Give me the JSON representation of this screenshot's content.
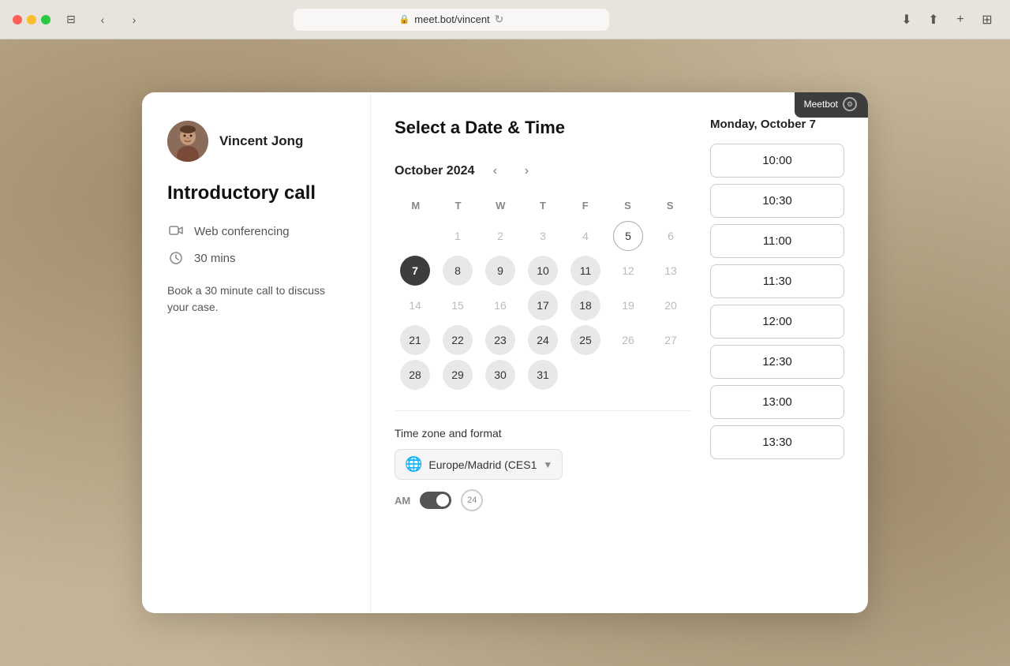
{
  "browser": {
    "url": "meet.bot/vincent",
    "lock_icon": "🔒",
    "refresh_icon": "↻"
  },
  "meetbot": {
    "label": "Meetbot"
  },
  "left_panel": {
    "profile_name": "Vincent Jong",
    "meeting_title": "Introductory call",
    "web_conferencing_label": "Web conferencing",
    "duration_label": "30 mins",
    "description": "Book a 30 minute call to discuss your case."
  },
  "calendar": {
    "section_title": "Select a Date & Time",
    "month_year": "October 2024",
    "weekdays": [
      "M",
      "T",
      "W",
      "T",
      "F",
      "S",
      "S"
    ],
    "selected_date_label": "Monday, October 7",
    "selected_day": 7,
    "days": [
      {
        "day": "",
        "type": "empty"
      },
      {
        "day": 1,
        "type": "inactive"
      },
      {
        "day": 2,
        "type": "inactive"
      },
      {
        "day": 3,
        "type": "inactive"
      },
      {
        "day": 4,
        "type": "inactive"
      },
      {
        "day": 5,
        "type": "today-ring"
      },
      {
        "day": 6,
        "type": "inactive"
      },
      {
        "day": 7,
        "type": "selected"
      },
      {
        "day": 8,
        "type": "available"
      },
      {
        "day": 9,
        "type": "available"
      },
      {
        "day": 10,
        "type": "available"
      },
      {
        "day": 11,
        "type": "available"
      },
      {
        "day": 12,
        "type": "inactive"
      },
      {
        "day": 13,
        "type": "inactive"
      },
      {
        "day": 14,
        "type": "inactive"
      },
      {
        "day": 15,
        "type": "inactive"
      },
      {
        "day": 16,
        "type": "inactive"
      },
      {
        "day": 17,
        "type": "available"
      },
      {
        "day": 18,
        "type": "available"
      },
      {
        "day": 19,
        "type": "inactive"
      },
      {
        "day": 20,
        "type": "inactive"
      },
      {
        "day": 21,
        "type": "available"
      },
      {
        "day": 22,
        "type": "available"
      },
      {
        "day": 23,
        "type": "available"
      },
      {
        "day": 24,
        "type": "available"
      },
      {
        "day": 25,
        "type": "available"
      },
      {
        "day": 26,
        "type": "inactive"
      },
      {
        "day": 27,
        "type": "inactive"
      },
      {
        "day": 28,
        "type": "available"
      },
      {
        "day": 29,
        "type": "available"
      },
      {
        "day": 30,
        "type": "available"
      },
      {
        "day": 31,
        "type": "available"
      },
      {
        "day": "",
        "type": "empty"
      },
      {
        "day": "",
        "type": "empty"
      },
      {
        "day": "",
        "type": "empty"
      }
    ]
  },
  "timezone": {
    "label": "Time zone and format",
    "timezone_value": "Europe/Madrid (CES1",
    "am_label": "AM",
    "format_24_label": "24"
  },
  "timeslots": {
    "slots": [
      "10:00",
      "10:30",
      "11:00",
      "11:30",
      "12:00",
      "12:30",
      "13:00",
      "13:30"
    ]
  }
}
